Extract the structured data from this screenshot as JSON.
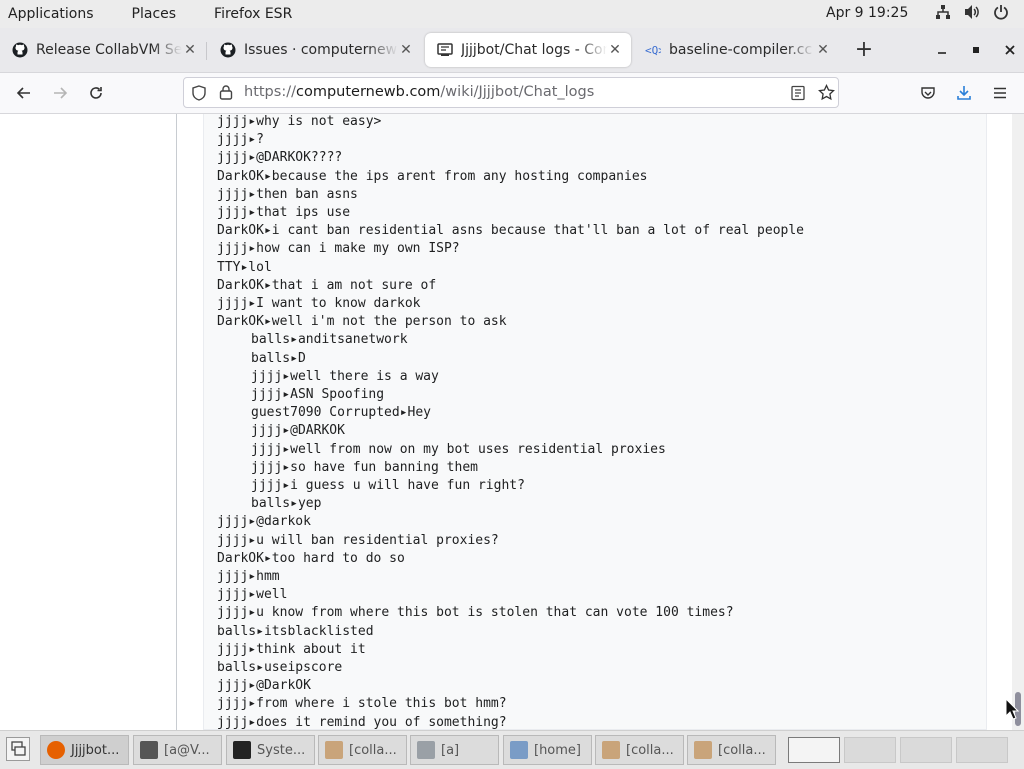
{
  "topbar": {
    "applications": "Applications",
    "places": "Places",
    "app_name": "Firefox ESR",
    "datetime": "Apr 9  19:25"
  },
  "tabs": [
    {
      "label": "Release CollabVM Serv",
      "icon": "github-icon",
      "active": false
    },
    {
      "label": "Issues · computernewb",
      "icon": "github-icon",
      "active": false
    },
    {
      "label": "Jjjjbot/Chat logs - Comp",
      "icon": "wiki-icon",
      "active": true
    },
    {
      "label": "baseline-compiler.cc - c",
      "icon": "code-search-icon",
      "active": false
    }
  ],
  "urlbar": {
    "prefix": "https://",
    "host": "computernewb.com",
    "path": "/wiki/Jjjjbot/Chat_logs"
  },
  "chat_lines": [
    {
      "text": "jjjj▸why is not easy>",
      "indent": false
    },
    {
      "text": "jjjj▸?",
      "indent": false
    },
    {
      "text": "jjjj▸@DARKOK????",
      "indent": false
    },
    {
      "text": "DarkOK▸because the ips arent from any hosting companies",
      "indent": false
    },
    {
      "text": "jjjj▸then ban asns",
      "indent": false
    },
    {
      "text": "jjjj▸that ips use",
      "indent": false
    },
    {
      "text": "DarkOK▸i cant ban residential asns because that'll ban a lot of real people",
      "indent": false
    },
    {
      "text": "jjjj▸how can i make my own ISP?",
      "indent": false
    },
    {
      "text": "TTY▸lol",
      "indent": false
    },
    {
      "text": "DarkOK▸that i am not sure of",
      "indent": false
    },
    {
      "text": "jjjj▸I want to know darkok",
      "indent": false
    },
    {
      "text": "DarkOK▸well i'm not the person to ask",
      "indent": false
    },
    {
      "text": "balls▸anditsanetwork",
      "indent": true
    },
    {
      "text": "balls▸D",
      "indent": true
    },
    {
      "text": "jjjj▸well there is a way",
      "indent": true
    },
    {
      "text": "jjjj▸ASN Spoofing",
      "indent": true
    },
    {
      "text": "guest7090 Corrupted▸Hey",
      "indent": true
    },
    {
      "text": "jjjj▸@DARKOK",
      "indent": true
    },
    {
      "text": "jjjj▸well from now on my bot uses residential proxies",
      "indent": true
    },
    {
      "text": "jjjj▸so have fun banning them",
      "indent": true
    },
    {
      "text": "jjjj▸i guess u will have fun right?",
      "indent": true
    },
    {
      "text": "balls▸yep",
      "indent": true
    },
    {
      "text": "jjjj▸@darkok",
      "indent": false
    },
    {
      "text": "jjjj▸u will ban residential proxies?",
      "indent": false
    },
    {
      "text": "DarkOK▸too hard to do so",
      "indent": false
    },
    {
      "text": "jjjj▸hmm",
      "indent": false
    },
    {
      "text": "jjjj▸well",
      "indent": false
    },
    {
      "text": "jjjj▸u know from where this bot is stolen that can vote 100 times?",
      "indent": false
    },
    {
      "text": "balls▸itsblacklisted",
      "indent": false
    },
    {
      "text": "jjjj▸think about it",
      "indent": false
    },
    {
      "text": "balls▸useipscore",
      "indent": false
    },
    {
      "text": "jjjj▸@DarkOK",
      "indent": false
    },
    {
      "text": "jjjj▸from where i stole this bot hmm?",
      "indent": false
    },
    {
      "text": "jjjj▸does it remind you of something?",
      "indent": false
    }
  ],
  "taskbar": {
    "tasks": [
      {
        "label": "Jjjjbot...",
        "icon": "firefox-icon",
        "color": "#e66000"
      },
      {
        "label": "[a@V...",
        "icon": "terminal-icon",
        "color": "#555555"
      },
      {
        "label": "Syste...",
        "icon": "system-monitor-icon",
        "color": "#222222"
      },
      {
        "label": "[colla...",
        "icon": "archive-icon",
        "color": "#c9a47a"
      },
      {
        "label": "[a]",
        "icon": "computer-icon",
        "color": "#9aa0a6"
      },
      {
        "label": "[home]",
        "icon": "document-icon",
        "color": "#7a9cc6"
      },
      {
        "label": "[colla...",
        "icon": "archive-icon",
        "color": "#c9a47a"
      },
      {
        "label": "[colla...",
        "icon": "archive-icon",
        "color": "#c9a47a"
      }
    ]
  }
}
